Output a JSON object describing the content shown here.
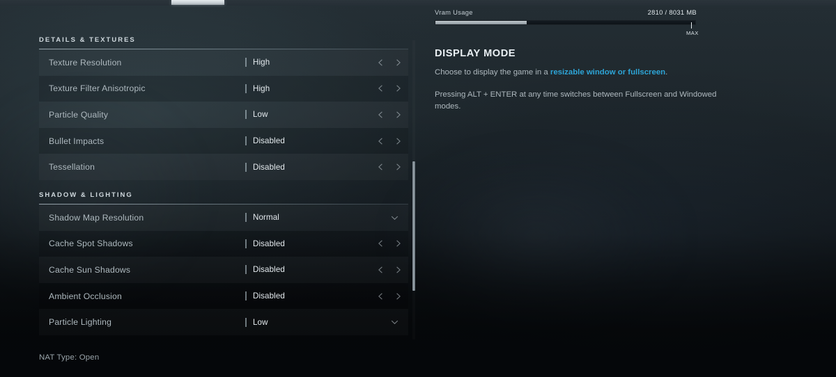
{
  "top_tab": {
    "indicator": "active-tab-underline"
  },
  "vram": {
    "label": "Vram Usage",
    "value_text": "2810 / 8031 MB",
    "used_mb": 2810,
    "total_mb": 8031,
    "fill_percent": 35,
    "max_marker_label": "MAX"
  },
  "info_panel": {
    "title": "DISPLAY MODE",
    "description_pre": "Choose to display the game in a ",
    "description_accent": "resizable window or fullscreen",
    "description_post": ".",
    "note": "Pressing ALT + ENTER at any time switches between Fullscreen and Windowed modes."
  },
  "sections": [
    {
      "title": "DETAILS & TEXTURES",
      "rows": [
        {
          "label": "Texture Resolution",
          "value": "High",
          "control": "stepper"
        },
        {
          "label": "Texture Filter Anisotropic",
          "value": "High",
          "control": "stepper"
        },
        {
          "label": "Particle Quality",
          "value": "Low",
          "control": "stepper"
        },
        {
          "label": "Bullet Impacts",
          "value": "Disabled",
          "control": "stepper"
        },
        {
          "label": "Tessellation",
          "value": "Disabled",
          "control": "stepper"
        }
      ]
    },
    {
      "title": "SHADOW & LIGHTING",
      "rows": [
        {
          "label": "Shadow Map Resolution",
          "value": "Normal",
          "control": "dropdown"
        },
        {
          "label": "Cache Spot Shadows",
          "value": "Disabled",
          "control": "stepper"
        },
        {
          "label": "Cache Sun Shadows",
          "value": "Disabled",
          "control": "stepper"
        },
        {
          "label": "Ambient Occlusion",
          "value": "Disabled",
          "control": "stepper"
        },
        {
          "label": "Particle Lighting",
          "value": "Low",
          "control": "dropdown"
        }
      ]
    }
  ],
  "footer": {
    "nat_type": "NAT Type: Open"
  },
  "colors": {
    "accent": "#2da4d6",
    "panel_text": "#aeb9bf",
    "value_text": "#e4eaee"
  }
}
